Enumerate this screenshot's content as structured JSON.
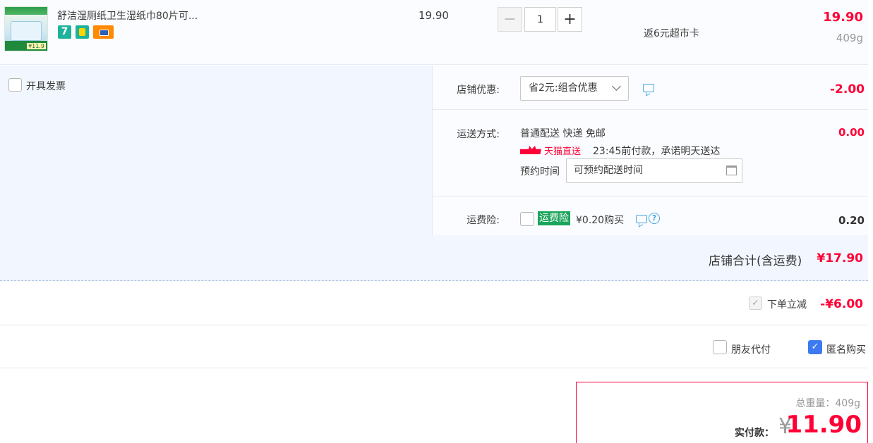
{
  "item": {
    "title": "舒洁湿厕纸卫生湿纸巾80片可...",
    "badge_seven": "7",
    "thumb_tag": "¥11.9",
    "unit_price": "19.90",
    "quantity": "1",
    "rebate": "返6元超市卡",
    "subtotal": "19.90",
    "weight": "409g"
  },
  "invoice": {
    "label": "开具发票"
  },
  "coupon": {
    "label": "店铺优惠:",
    "selected": "省2元:组合优惠",
    "value": "-2.00"
  },
  "shipping": {
    "label": "运送方式:",
    "method": "普通配送 快递 免邮",
    "tmall_label": "天猫直送",
    "promise": "23:45前付款，承诺明天送达",
    "book_label": "预约时间",
    "book_placeholder": "可预约配送时间",
    "value": "0.00"
  },
  "insurance": {
    "label": "运费险:",
    "tag": "运费险",
    "price": "¥0.20购买",
    "help": "?",
    "value": "0.20"
  },
  "shop_total": {
    "label": "店铺合计(含运费)",
    "value": "¥17.90"
  },
  "discount": {
    "label": "下单立减",
    "value": "-¥6.00",
    "checked": true
  },
  "options": {
    "friend_pay": "朋友代付",
    "anonymous": "匿名购买",
    "anonymous_checked": true
  },
  "summary": {
    "total_weight": "总重量：409g",
    "pay_label": "实付款：",
    "yen": "¥",
    "amount": "11.90"
  },
  "colors": {
    "accent": "#ff0036",
    "checkbox_blue": "#3d7af2",
    "insurance_green": "#1aa55a"
  },
  "icons": [
    "minus-icon",
    "plus-icon",
    "chevron-down-icon",
    "chat-icon",
    "calendar-icon",
    "help-icon",
    "check-icon"
  ]
}
